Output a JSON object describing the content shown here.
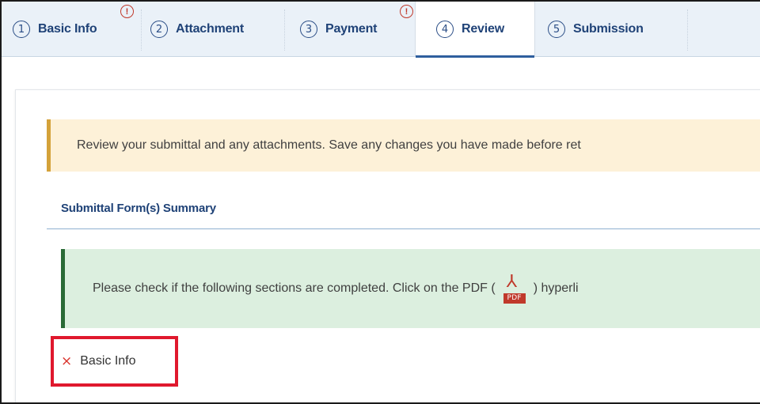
{
  "tabs": [
    {
      "number": "1",
      "label": "Basic Info",
      "warning": true,
      "warning_icon": "!"
    },
    {
      "number": "2",
      "label": "Attachment",
      "warning": false
    },
    {
      "number": "3",
      "label": "Payment",
      "warning": true,
      "warning_icon": "!"
    },
    {
      "number": "4",
      "label": "Review",
      "warning": false,
      "active": true
    },
    {
      "number": "5",
      "label": "Submission",
      "warning": false
    }
  ],
  "review_notice": "Review your submittal and any attachments. Save any changes you have made before ret",
  "summary": {
    "title": "Submittal Form(s) Summary",
    "info_before_icon": "Please check if the following sections are completed. Click on the PDF (",
    "pdf_icon_label": "PDF",
    "info_after_icon": ") hyperli",
    "items": [
      {
        "status_icon": "×",
        "label": "Basic Info",
        "completed": false
      }
    ]
  },
  "colors": {
    "tab_text": "#1f4277",
    "warning_red": "#c0392b",
    "highlight_box": "#e0182d",
    "notice_warn_bg": "#fdf1d8",
    "notice_info_bg": "#dcefdf"
  }
}
